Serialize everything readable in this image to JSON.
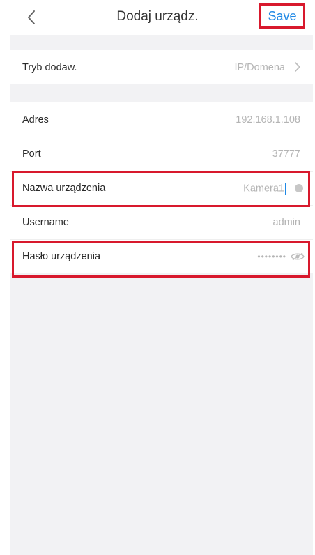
{
  "header": {
    "title": "Dodaj urządz.",
    "save_label": "Save"
  },
  "form": {
    "tryb": {
      "label": "Tryb dodaw.",
      "value": "IP/Domena"
    },
    "adres": {
      "label": "Adres",
      "value": "192.168.1.108"
    },
    "port": {
      "label": "Port",
      "value": "37777"
    },
    "nazwa": {
      "label": "Nazwa urządzenia",
      "value": "Kamera1"
    },
    "username": {
      "label": "Username",
      "value": "admin"
    },
    "haslo": {
      "label": "Hasło urządzenia",
      "value": "••••••••"
    }
  },
  "colors": {
    "accent": "#1e88e5",
    "highlight": "#d8192d",
    "background": "#f2f2f4"
  },
  "icons": {
    "back": "chevron-left-icon",
    "tryb_arrow": "chevron-right-icon",
    "clear": "clear-icon",
    "visibility": "eye-icon"
  }
}
